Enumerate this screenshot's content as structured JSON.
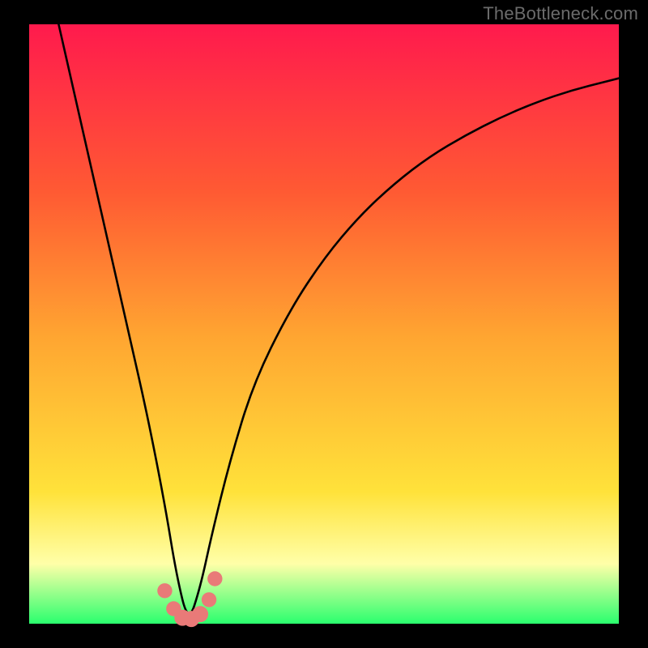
{
  "watermark": "TheBottleneck.com",
  "colors": {
    "frame": "#000000",
    "grad_top": "#ff1a4d",
    "grad_up_mid": "#ff5a33",
    "grad_mid": "#ffa531",
    "grad_low_mid": "#ffe23a",
    "grad_pale": "#ffffa8",
    "grad_bottom": "#2aff6e",
    "curve": "#000000",
    "markers_fill": "#e97a78",
    "markers_stroke": "#c94a47"
  },
  "chart_data": {
    "type": "line",
    "title": "",
    "xlabel": "",
    "ylabel": "",
    "xlim": [
      0,
      100
    ],
    "ylim": [
      0,
      100
    ],
    "dip_x": 27,
    "series": [
      {
        "name": "bottleneck-curve",
        "x": [
          5,
          8,
          11,
          14,
          17,
          20,
          23,
          25,
          27,
          29,
          31,
          34,
          38,
          44,
          50,
          56,
          62,
          68,
          74,
          80,
          86,
          92,
          98,
          100
        ],
        "values": [
          100,
          87,
          74,
          61,
          48,
          35,
          20,
          8,
          0,
          6,
          15,
          27,
          40,
          52,
          61,
          68,
          73.5,
          78,
          81.5,
          84.5,
          87,
          89,
          90.5,
          91
        ]
      }
    ],
    "markers": {
      "name": "highlight-cluster",
      "points": [
        {
          "x": 23.0,
          "y": 5.5,
          "r": 1.3
        },
        {
          "x": 24.5,
          "y": 2.5,
          "r": 1.3
        },
        {
          "x": 26.0,
          "y": 1.0,
          "r": 1.5
        },
        {
          "x": 27.5,
          "y": 0.8,
          "r": 1.5
        },
        {
          "x": 29.0,
          "y": 1.6,
          "r": 1.5
        },
        {
          "x": 30.5,
          "y": 4.0,
          "r": 1.3
        },
        {
          "x": 31.5,
          "y": 7.5,
          "r": 1.3
        }
      ]
    }
  }
}
